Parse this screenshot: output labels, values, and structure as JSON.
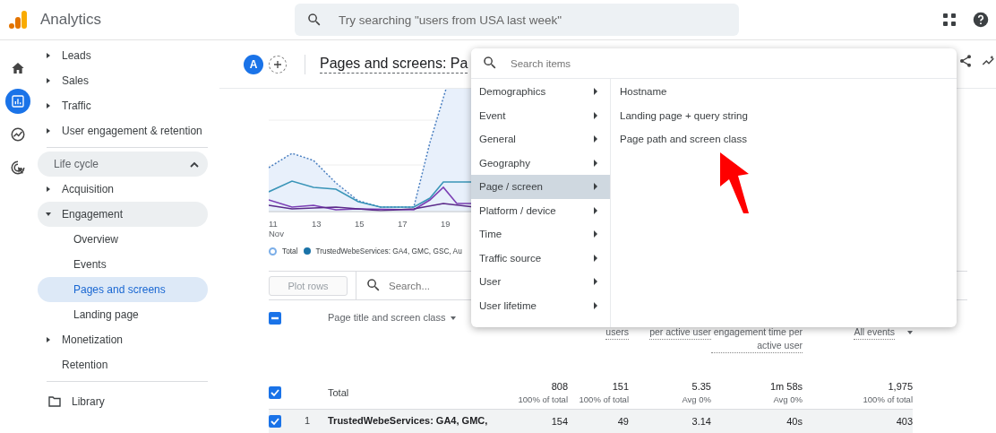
{
  "app_bar": {
    "product": "Analytics",
    "search": {
      "placeholder": "Try searching \"users from USA last week\""
    }
  },
  "rail": [
    {
      "kind": "home",
      "selected": false
    },
    {
      "kind": "reports",
      "selected": true
    },
    {
      "kind": "explore",
      "selected": false
    },
    {
      "kind": "advertising",
      "selected": false
    }
  ],
  "sidebar": {
    "items": [
      {
        "label": "Leads",
        "expanded": false
      },
      {
        "label": "Sales",
        "expanded": false
      },
      {
        "label": "Traffic",
        "expanded": false
      },
      {
        "label": "User engagement & retention",
        "expanded": false
      }
    ],
    "section": {
      "title": "Life cycle",
      "expanded": true,
      "items": [
        {
          "label": "Acquisition",
          "kind": "group",
          "expanded": false,
          "selected": false
        },
        {
          "label": "Engagement",
          "kind": "group",
          "expanded": true,
          "selected": false,
          "children": [
            {
              "label": "Overview",
              "selected": false
            },
            {
              "label": "Events",
              "selected": false
            },
            {
              "label": "Pages and screens",
              "selected": true
            },
            {
              "label": "Landing page",
              "selected": false
            }
          ]
        },
        {
          "label": "Monetization",
          "kind": "group",
          "expanded": false,
          "selected": false
        },
        {
          "label": "Retention",
          "kind": "link",
          "selected": false
        }
      ]
    },
    "footer": {
      "label": "Library"
    }
  },
  "report": {
    "avatar": "A",
    "title": "Pages and screens: Pa",
    "chart": {
      "x_labels": [
        {
          "label": "11",
          "sub": "Nov"
        },
        {
          "label": "13"
        },
        {
          "label": "15"
        },
        {
          "label": "17"
        },
        {
          "label": "19"
        }
      ],
      "legend": [
        {
          "label": "Total",
          "kind": "hollow",
          "color": "#7baee8"
        },
        {
          "label": "TrustedWebeServices: GA4, GMC, GSC, Au",
          "kind": "filled",
          "color": "#1a73a8"
        }
      ]
    },
    "toolbar": {
      "plot_rows": "Plot rows",
      "search_placeholder": "Search..."
    },
    "table": {
      "select_all": {
        "indeterminate": true
      },
      "dimension": {
        "label": "Page title and screen class"
      },
      "metric_headers": [
        {
          "label": "users",
          "dropdown": false
        },
        {
          "label": "per active user",
          "dropdown": false
        },
        {
          "label": "engagement time per active user",
          "dropdown": false
        },
        {
          "label": "All events",
          "dropdown": true
        }
      ],
      "rows": [
        {
          "kind": "total",
          "checked": true,
          "label": "Total",
          "cells": [
            {
              "value": "808",
              "note": "100% of total"
            },
            {
              "value": "151",
              "note": "100% of total"
            },
            {
              "value": "5.35",
              "note": "Avg 0%"
            },
            {
              "value": "1m 58s",
              "note": "Avg 0%"
            },
            {
              "value": "1,975",
              "note": "100% of total"
            }
          ]
        },
        {
          "kind": "data",
          "checked": true,
          "index": "1",
          "label": "TrustedWebeServices: GA4, GMC,",
          "cells": [
            {
              "value": "154"
            },
            {
              "value": "49"
            },
            {
              "value": "3.14"
            },
            {
              "value": "40s"
            },
            {
              "value": "403"
            }
          ]
        }
      ]
    }
  },
  "menu": {
    "search": {
      "placeholder": "Search items"
    },
    "categories": [
      {
        "label": "Demographics",
        "selected": false
      },
      {
        "label": "Event",
        "selected": false
      },
      {
        "label": "General",
        "selected": false
      },
      {
        "label": "Geography",
        "selected": false
      },
      {
        "label": "Page / screen",
        "selected": true
      },
      {
        "label": "Platform / device",
        "selected": false
      },
      {
        "label": "Time",
        "selected": false
      },
      {
        "label": "Traffic source",
        "selected": false
      },
      {
        "label": "User",
        "selected": false
      },
      {
        "label": "User lifetime",
        "selected": false
      }
    ],
    "items": [
      {
        "label": "Hostname"
      },
      {
        "label": "Landing page + query string"
      },
      {
        "label": "Page path and screen class"
      }
    ]
  }
}
